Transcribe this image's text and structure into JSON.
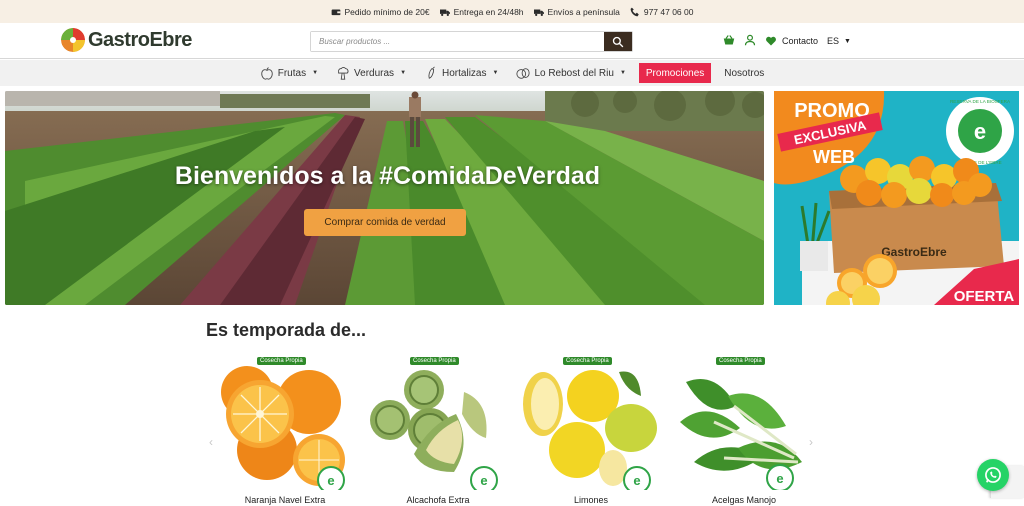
{
  "topbar": {
    "items": [
      {
        "icon": "wallet-icon",
        "label": "Pedido mínimo de 20€"
      },
      {
        "icon": "truck-icon",
        "label": "Entrega en 24/48h"
      },
      {
        "icon": "delivery-truck-icon",
        "label": "Envíos a península"
      },
      {
        "icon": "phone-icon",
        "label": "977 47 06 00"
      }
    ]
  },
  "header": {
    "logo_text": "GastroEbre",
    "search_placeholder": "Buscar productos ...",
    "contact_label": "Contacto",
    "language": "ES"
  },
  "nav": {
    "items": [
      {
        "label": "Frutas",
        "icon": "apple-icon",
        "dropdown": true
      },
      {
        "label": "Verduras",
        "icon": "broccoli-icon",
        "dropdown": true
      },
      {
        "label": "Hortalizas",
        "icon": "carrot-icon",
        "dropdown": true
      },
      {
        "label": "Lo Rebost del Riu",
        "icon": "jar-icon",
        "dropdown": true
      }
    ],
    "promo_label": "Promociones",
    "about_label": "Nosotros"
  },
  "hero": {
    "title": "Bienvenidos a la #ComidaDeVerdad",
    "cta": "Comprar comida de verdad"
  },
  "promo": {
    "line1": "PROMO",
    "line2": "EXCLUSIVA",
    "line3": "WEB",
    "box_brand": "GastroEbre",
    "seal_top": "RESERVA DE LA BIOSFERA",
    "seal_bottom": "TERRES DE L'EBRE",
    "ribbon": "OFERTA"
  },
  "season": {
    "title": "Es temporada de...",
    "products": [
      {
        "name": "Naranja Navel Extra",
        "badge": "Cosecha Propia"
      },
      {
        "name": "Alcachofa Extra",
        "badge": "Cosecha Propia"
      },
      {
        "name": "Limones",
        "badge": "Cosecha Propia"
      },
      {
        "name": "Acelgas Manojo",
        "badge": "Cosecha Propia"
      }
    ]
  },
  "colors": {
    "promo_red": "#e8294c",
    "cta_orange": "#f0a142",
    "topbar_bg": "#f7efe4",
    "search_button": "#3b2c20",
    "accent_green": "#2f8a2a"
  }
}
